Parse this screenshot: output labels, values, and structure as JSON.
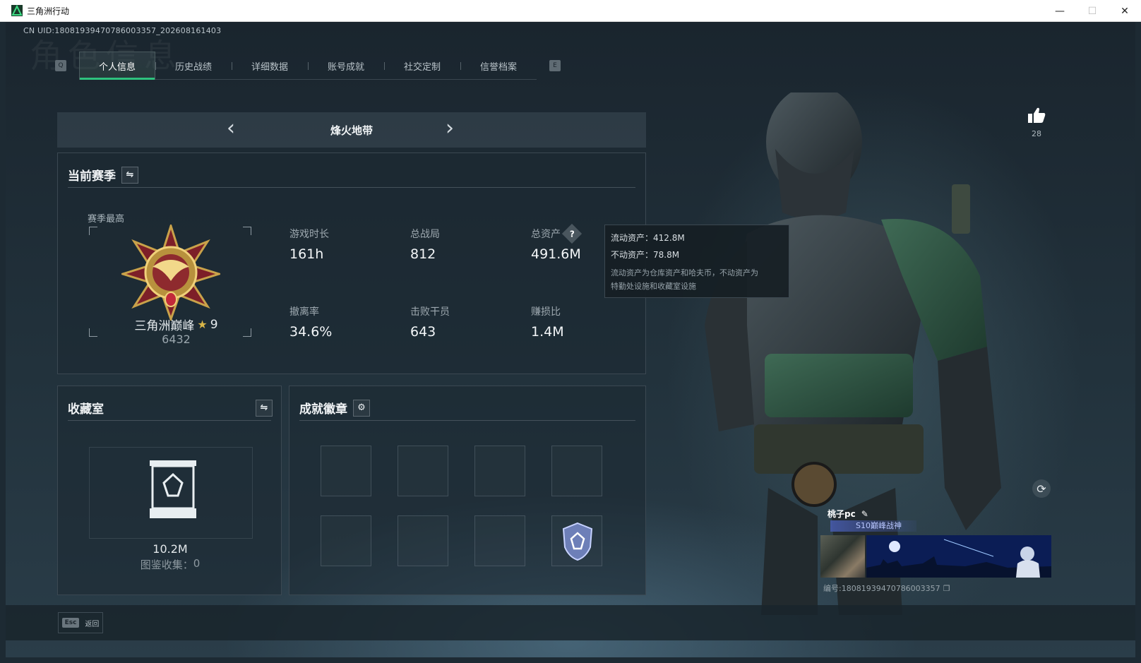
{
  "window": {
    "title": "三角洲行动",
    "min": "—",
    "max": "☐",
    "close": "✕"
  },
  "uid": "CN UID:1808193947078600335​7_202608161403",
  "watermark": "角色信息",
  "tabs": {
    "left_key": "Q",
    "right_key": "E",
    "items": [
      {
        "label": "个人信息"
      },
      {
        "label": "历史战绩"
      },
      {
        "label": "详细数据"
      },
      {
        "label": "账号成就"
      },
      {
        "label": "社交定制"
      },
      {
        "label": "信誉档案"
      }
    ]
  },
  "mode": {
    "title": "烽火地带",
    "prev": "‹",
    "next": "›"
  },
  "season": {
    "heading": "当前赛季",
    "best_label": "赛季最高",
    "rank_name": "三角洲巅峰",
    "rank_stars": "9",
    "rank_score": "6432",
    "stats": [
      {
        "label": "游戏时长",
        "value": "161h"
      },
      {
        "label": "总战局",
        "value": "812"
      },
      {
        "label": "总资产",
        "value": "491.6M"
      },
      {
        "label": "撤离率",
        "value": "34.6%"
      },
      {
        "label": "击败干员",
        "value": "643"
      },
      {
        "label": "赚损比",
        "value": "1.4M"
      }
    ]
  },
  "tooltip": {
    "liquid": "流动资产：412.8M",
    "fixed": "不动资产：78.8M",
    "note_line1": "流动资产为仓库资产和哈夫币，不动资产为",
    "note_line2": "特勤处设施和收藏室设施"
  },
  "collection": {
    "heading": "收藏室",
    "value": "10.2M",
    "count_label": "图鉴收集：",
    "count": "0"
  },
  "achievements": {
    "heading": "成就徽章"
  },
  "like": {
    "count": "28"
  },
  "card": {
    "name": "桃子pc",
    "title": "S10巅峰战神",
    "id": "编号:180819394707860​03357"
  },
  "footer": {
    "esc_key": "Esc",
    "esc_label": "返回"
  },
  "colors": {
    "accent": "#2ec27e",
    "panel": "#1c2831",
    "gold": "#d8b548"
  }
}
